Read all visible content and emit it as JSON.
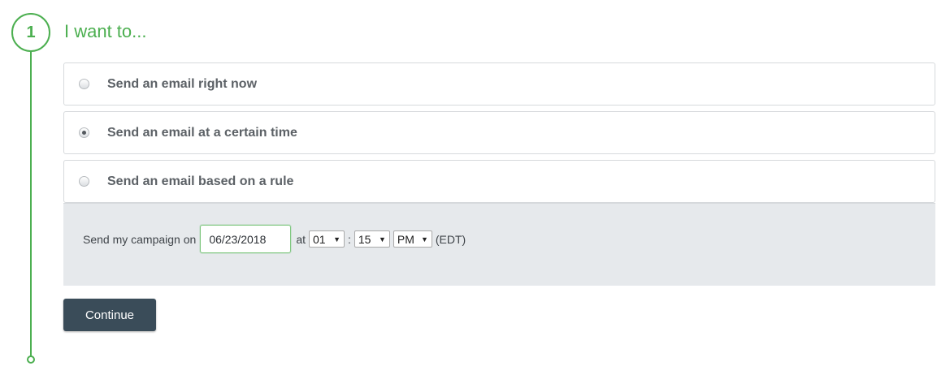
{
  "step": {
    "number": "1",
    "title": "I want to..."
  },
  "options": [
    {
      "label": "Send an email right now",
      "selected": false
    },
    {
      "label": "Send an email at a certain time",
      "selected": true
    },
    {
      "label": "Send an email based on a rule",
      "selected": false
    }
  ],
  "schedule": {
    "prefix_label": "Send my campaign on",
    "date_value": "06/23/2018",
    "at_label": "at",
    "hour": "01",
    "colon": ":",
    "minute": "15",
    "ampm": "PM",
    "timezone": "(EDT)"
  },
  "actions": {
    "continue_label": "Continue"
  },
  "colors": {
    "accent_green": "#4caf50",
    "button_bg": "#3a4c59",
    "panel_bg": "#e6e9ec"
  }
}
